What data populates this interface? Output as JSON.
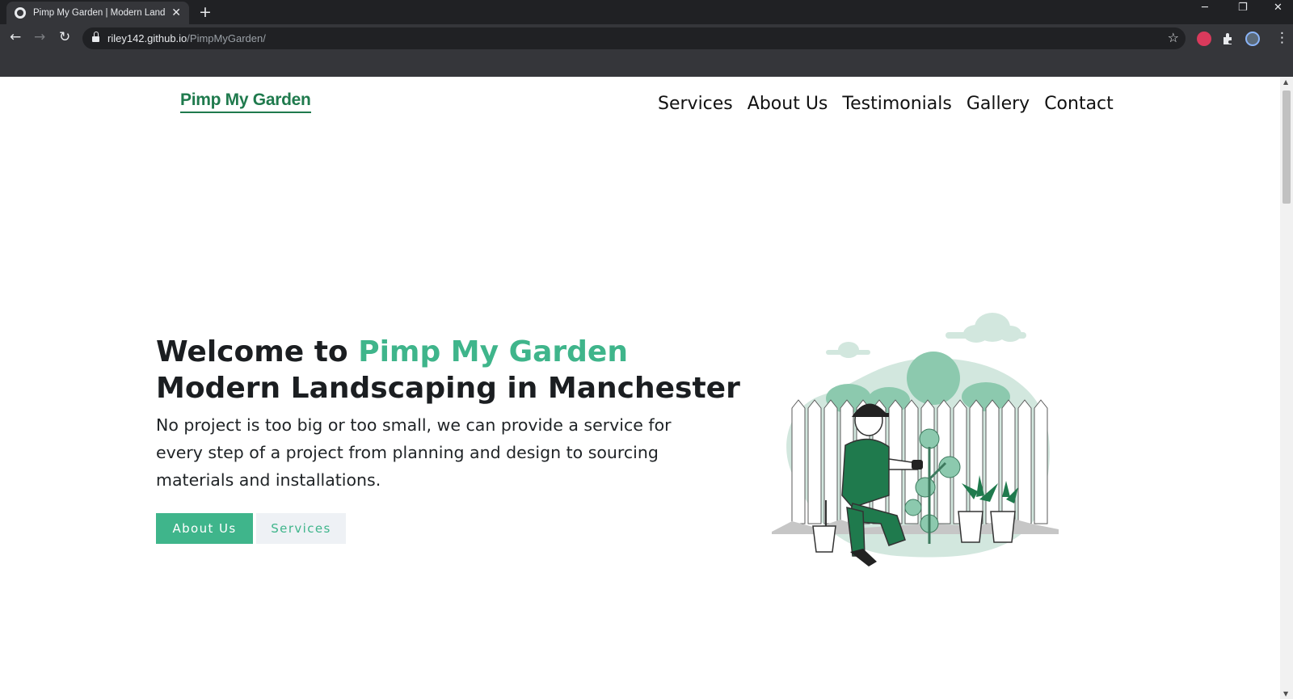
{
  "browser": {
    "tab_title": "Pimp My Garden | Modern Landscaping",
    "tab_close": "✕",
    "new_tab": "+",
    "url_host": "riley142.github.io",
    "url_path": "/PimpMyGarden/",
    "minimize": "─",
    "restore": "❐",
    "close": "✕",
    "back": "←",
    "forward": "→",
    "reload": "↻",
    "bookmark_icon": "☆",
    "menu": "⋮"
  },
  "site": {
    "logo": "Pimp My Garden",
    "nav": [
      "Services",
      "About Us",
      "Testimonials",
      "Gallery",
      "Contact"
    ],
    "hero": {
      "title_prefix": "Welcome to ",
      "title_accent": "Pimp My Garden",
      "title_line2": "Modern Landscaping in Manchester",
      "text": "No project is too big or too small, we can provide a service for every step of a project from planning and design to sourcing materials and installations."
    },
    "buttons": {
      "primary": "About Us",
      "secondary": "Services"
    }
  },
  "colors": {
    "accent": "#3fb58b",
    "logo_green": "#1f7a4d",
    "chrome_dark": "#202124",
    "chrome_toolbar": "#35363a"
  },
  "icons": [
    "favicon-globe-icon",
    "close-icon",
    "plus-icon",
    "back-icon",
    "forward-icon",
    "reload-icon",
    "lock-icon",
    "star-icon",
    "extensions-icon",
    "profile-avatar",
    "kebab-menu-icon",
    "gardener-illustration"
  ]
}
